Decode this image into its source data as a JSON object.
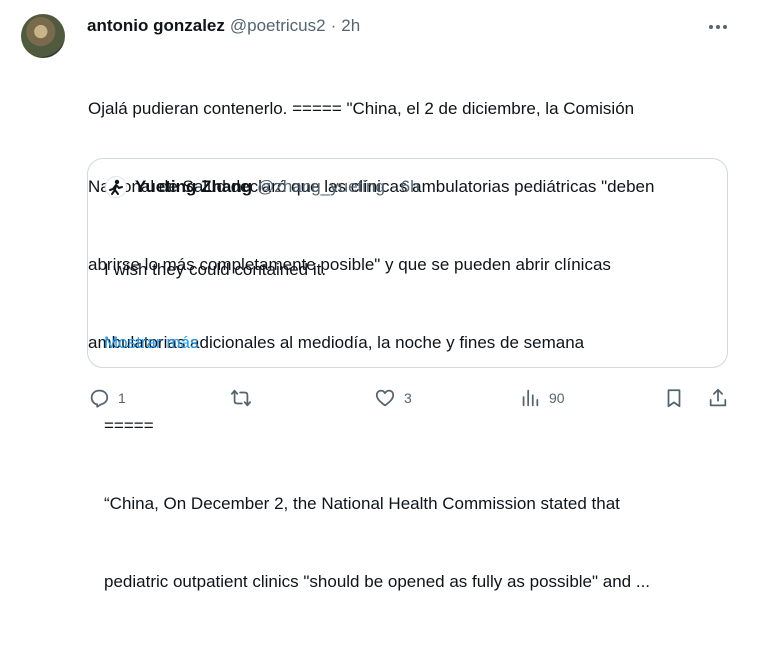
{
  "tweet": {
    "display_name": "antonio gonzalez",
    "handle": "@poetricus2",
    "separator": "·",
    "time": "2h",
    "text_lines": [
      "Ojalá pudieran contenerlo. ===== \"China, el 2 de diciembre, la Comisión",
      "Nacional de Salud declaró que las clínicas ambulatorias pediátricas \"deben",
      "abrirse lo más completamente posible\" y que se pueden abrir clínicas",
      "ambulatorias adicionales al mediodía, la noche y fines de semana"
    ]
  },
  "quote": {
    "display_name": "Yueting Zhang",
    "handle": "@zhang_yueting",
    "separator": "·",
    "time": "6h",
    "lines": [
      "I wish they could contained it.",
      "",
      "=====",
      "“China, On December 2, the National Health Commission stated that",
      "pediatric outpatient clinics \"should be opened as fully as possible\" and ..."
    ],
    "show_more": "Mostrar más"
  },
  "actions": {
    "replies": "1",
    "retweets": "",
    "likes": "3",
    "views": "90"
  },
  "icons": {
    "more": "more-horizontal-icon",
    "reply": "reply-icon",
    "retweet": "retweet-icon",
    "like": "heart-icon",
    "views": "views-chart-icon",
    "bookmark": "bookmark-icon",
    "share": "share-icon"
  },
  "colors": {
    "link": "#1d9bf0",
    "secondary_text": "#536471",
    "border": "#cfd9de"
  }
}
